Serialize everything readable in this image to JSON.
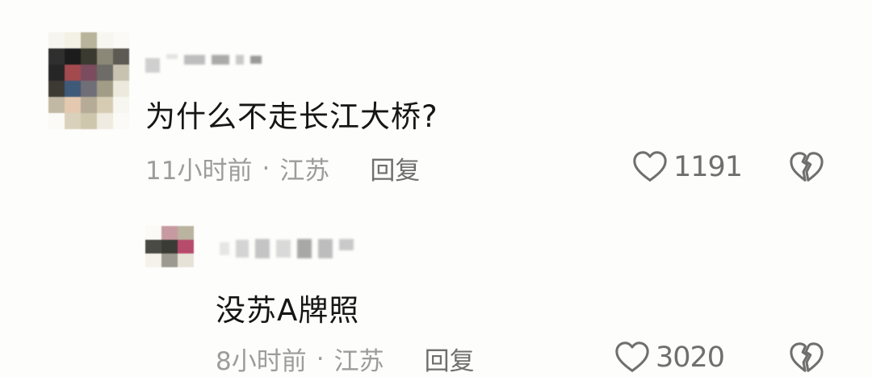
{
  "comments": [
    {
      "text": "为什么不走长江大桥?",
      "time": "11小时前",
      "separator": "·",
      "location": "江苏",
      "reply_label": "回复",
      "likes": "1191",
      "like_icon": "heart-outline-icon",
      "dislike_icon": "broken-heart-icon",
      "avatar_icon": "pixelated-avatar"
    },
    {
      "text": "没苏A牌照",
      "time": "8小时前",
      "separator": "·",
      "location": "江苏",
      "reply_label": "回复",
      "likes": "3020",
      "like_icon": "heart-outline-icon",
      "dislike_icon": "broken-heart-icon",
      "avatar_icon": "pixelated-avatar"
    }
  ],
  "colors": {
    "background": "#fdfdfb",
    "text": "#161616",
    "meta": "#9c9c9c",
    "icon": "#6f6f6f"
  }
}
